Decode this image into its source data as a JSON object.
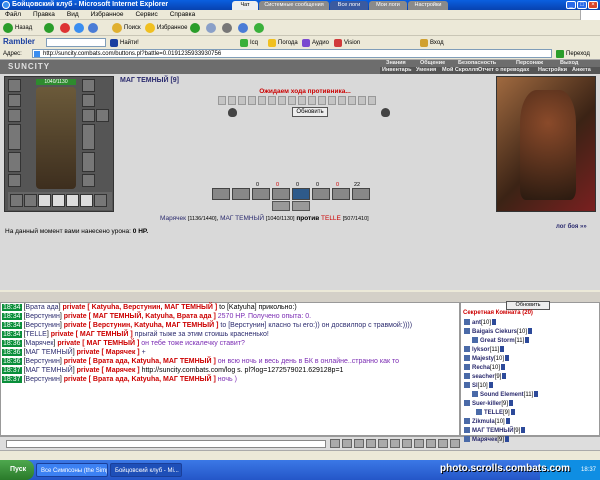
{
  "window": {
    "title": "Бойцовский клуб - Microsoft Internet Explorer"
  },
  "menu": [
    "Файл",
    "Правка",
    "Вид",
    "Избранное",
    "Сервис",
    "Справка"
  ],
  "toolbar": {
    "back": "Назад",
    "search": "Поиск",
    "favorites": "Избранное",
    "rambler": "Rambler",
    "find": "Найти!",
    "icq": "Icq",
    "weather": "Погода",
    "audio": "Аудио",
    "vision": "Vision",
    "login": "Вход"
  },
  "address": {
    "label": "Адрес:",
    "url": "http://suncity.combats.com/buttons.pl?battle=0.0191235933930756",
    "go": "Переход"
  },
  "game": {
    "logo": "SUNCITY",
    "nav_top": [
      "Знания",
      "Общение",
      "Безопасность",
      "Персонаж",
      "Выход"
    ],
    "nav_sub": [
      "Инвентарь",
      "Умения",
      "Мой Скроллп",
      "Отчет о переводах",
      "Настройки",
      "Анкета"
    ],
    "player_name": "МАГ ТЕМНЫЙ [9]",
    "player_hp": "1040/1130",
    "waiting": "Ожидаем хода противника...",
    "refresh": "Обновить",
    "stats": [
      "0",
      "0",
      "0",
      "0",
      "0",
      "22"
    ],
    "ally1": "Марячек",
    "ally1_hp": "[1136/1440]",
    "ally2": "МАГ ТЕМНЫЙ",
    "ally2_hp": "[1040/1130]",
    "versus": "против",
    "enemy": "TELLE",
    "enemy_hp": "[507/1410]",
    "damage_text": "На данный момент вами нанесено урона:",
    "damage_value": "0 HP.",
    "log_link": "лог боя »»"
  },
  "tabs": [
    "Чат",
    "Системные сообщения",
    "Все логи",
    "Мои логи",
    "Настройки"
  ],
  "chat": [
    {
      "time": "18:34",
      "from": "Врата ада",
      "scope": "private",
      "to": "[ Katyuha, Верстунин, МАГ ТЕМНЫЙ ]",
      "text": "to [Katyuha] прикольно:)",
      "tone": "nm"
    },
    {
      "time": "18:34",
      "from": "Верстунин",
      "scope": "private",
      "to": "[ МАГ ТЕМНЫЙ, Katyuha, Врата ада ]",
      "text": "2570 HP. Получено опыта: 0.",
      "tone": "bl"
    },
    {
      "time": "18:34",
      "from": "Верстунин",
      "scope": "private",
      "to": "[ Верстунин, Katyuha, МАГ ТЕМНЫЙ ]",
      "text": "to [Верстунин] класно ты его:)) он досвилпор с травмой:))))",
      "tone": "nm"
    },
    {
      "time": "18:34",
      "from": "TELLE",
      "scope": "private",
      "to": "[ МАГ ТЕМНЫЙ ]",
      "text": "прыгай тыже за этим стоишь красненько!",
      "tone": "nm"
    },
    {
      "time": "18:36",
      "from": "Марячек",
      "scope": "private",
      "to": "[ МАГ ТЕМНЫЙ ]",
      "text": "он тебе тоже искалечку ставит?",
      "tone": "bl"
    },
    {
      "time": "18:36",
      "from": "МАГ ТЕМНЫЙ",
      "scope": "private",
      "to": "[ Марячек ]",
      "text": "+",
      "tone": "nm"
    },
    {
      "time": "18:36",
      "from": "Верстунин",
      "scope": "private",
      "to": "[ Врата ада, Katyuha, МАГ ТЕМНЫЙ ]",
      "text": "он всю ночь и весь день в БК в онлайне..странно как то",
      "tone": "bl"
    },
    {
      "time": "18:37",
      "from": "МАГ ТЕМНЫЙ",
      "scope": "private",
      "to": "[ Марячек ]",
      "text": "http://suncity.combats.com/log s. pl?log=1272579021.629128p=1",
      "tone": "nm"
    },
    {
      "time": "18:37",
      "from": "Верстунин",
      "scope": "private",
      "to": "[ Врата ада, Katyuha, МАГ ТЕМНЫЙ ]",
      "text": "ночь )",
      "tone": "bl"
    }
  ],
  "sidebar": {
    "refresh": "Обновить",
    "room": "Секретная Комната (20)",
    "users": [
      {
        "name": "ant",
        "level": "[10]"
      },
      {
        "name": "Baigais Ciekurs",
        "level": "[10]"
      },
      {
        "name": "Great Storm",
        "level": "[11]"
      },
      {
        "name": "lyksor",
        "level": "[11]"
      },
      {
        "name": "Majesty",
        "level": "[10]"
      },
      {
        "name": "Recha",
        "level": "[10]"
      },
      {
        "name": "seacher",
        "level": "[9]"
      },
      {
        "name": "Sl",
        "level": "[10]"
      },
      {
        "name": "Sound Element",
        "level": "[11]"
      },
      {
        "name": "Suer-killer",
        "level": "[9]"
      },
      {
        "name": "TELLE",
        "level": "[9]"
      },
      {
        "name": "Zikmula",
        "level": "[10]"
      },
      {
        "name": "МАГ ТЕМНЫЙ",
        "level": "[9]"
      },
      {
        "name": "Марячек",
        "level": "[9]"
      }
    ]
  },
  "taskbar": {
    "start": "Пуск",
    "tasks": [
      "Все Симпсоны (the Simp...",
      "Бойцовский клуб - Mi..."
    ],
    "clock": "18:37"
  },
  "watermark": "photo.scrolls.combats.com"
}
